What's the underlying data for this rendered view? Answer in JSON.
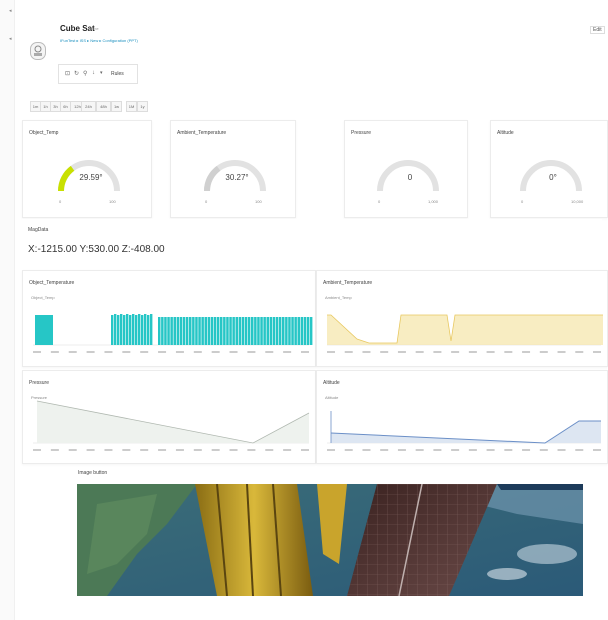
{
  "header": {
    "device_name": "Cube Sat",
    "status": "offline",
    "breadcrumb": "IFunTest ▸ ISS ▸ New ▸ Configuration (PPT)",
    "right_action": "Edit",
    "toolbar_label": "Rules"
  },
  "time_ranges": [
    "1m",
    "1h",
    "3h",
    "6h",
    "12h",
    "24h",
    "48h",
    "1w",
    "1M",
    "1y"
  ],
  "gauges": [
    {
      "title": "Object_Temp",
      "value": "29.59°",
      "min": "0",
      "max": "100",
      "fraction": 0.3,
      "color": "#c8e000"
    },
    {
      "title": "Ambient_Temperature",
      "value": "30.27°",
      "min": "0",
      "max": "100",
      "fraction": 0.3,
      "color": "#d0d0d0"
    },
    {
      "title": "Pressure",
      "value": "0",
      "min": "0",
      "max": "1,000",
      "fraction": 0.0,
      "color": "#d0d0d0"
    },
    {
      "title": "Altitude",
      "value": "0°",
      "min": "0",
      "max": "10,000",
      "fraction": 0.0,
      "color": "#d0d0d0"
    }
  ],
  "magnetometer": {
    "title": "MagData",
    "value": "X:-1215.00 Y:530.00 Z:-408.00"
  },
  "charts": [
    {
      "title": "Object_Temperature",
      "legend": "Object_Temp",
      "color": "#26c6c6"
    },
    {
      "title": "Ambient_Temperature",
      "legend": "Ambient_Temp",
      "color": "#f5e6a8"
    },
    {
      "title": "Pressure",
      "legend": "Pressure",
      "color": "#d0d0d0"
    },
    {
      "title": "Altitude",
      "legend": "Altitude",
      "color": "#6b8fc7"
    }
  ],
  "image_widget": {
    "title": "Image button"
  }
}
